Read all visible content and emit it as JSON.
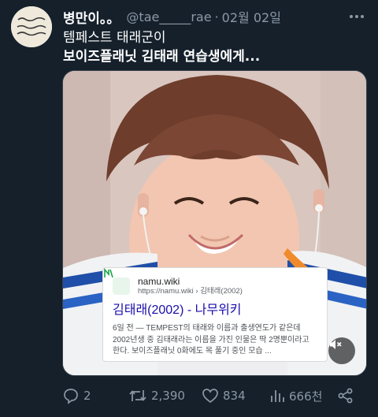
{
  "tweet": {
    "display_name": "병만이。。",
    "handle": "@tae_____rae",
    "separator": "·",
    "date": "02월 02일",
    "text_line1": "템페스트 태래군이",
    "text_line2": "보이즈플래닛 김태래 연습생에게..."
  },
  "card": {
    "favicon": "namu",
    "site": "namu.wiki",
    "url": "https://namu.wiki › 김태래(2002)",
    "title": "김태래(2002) - 나무위키",
    "snippet": "6일 전 — TEMPEST의 태래와 이름과 출생연도가 같은데 2002년생 중 김태래라는 이름을 가진 인물은 딱 2명뿐이라고 한다. 보이즈플래닛 0화에도 목 풀기 중인 모습 ..."
  },
  "actions": {
    "reply_count": "2",
    "retweet_count": "2,390",
    "like_count": "834",
    "views_count": "666천"
  },
  "icons": {
    "reply": "reply-icon",
    "retweet": "retweet-icon",
    "like": "heart-icon",
    "views": "views-icon",
    "share": "share-icon",
    "more": "more-icon",
    "mute": "mute-icon"
  },
  "colors": {
    "background": "#15202b",
    "secondary_text": "#8b98a5",
    "link_title": "#1a0dab"
  }
}
